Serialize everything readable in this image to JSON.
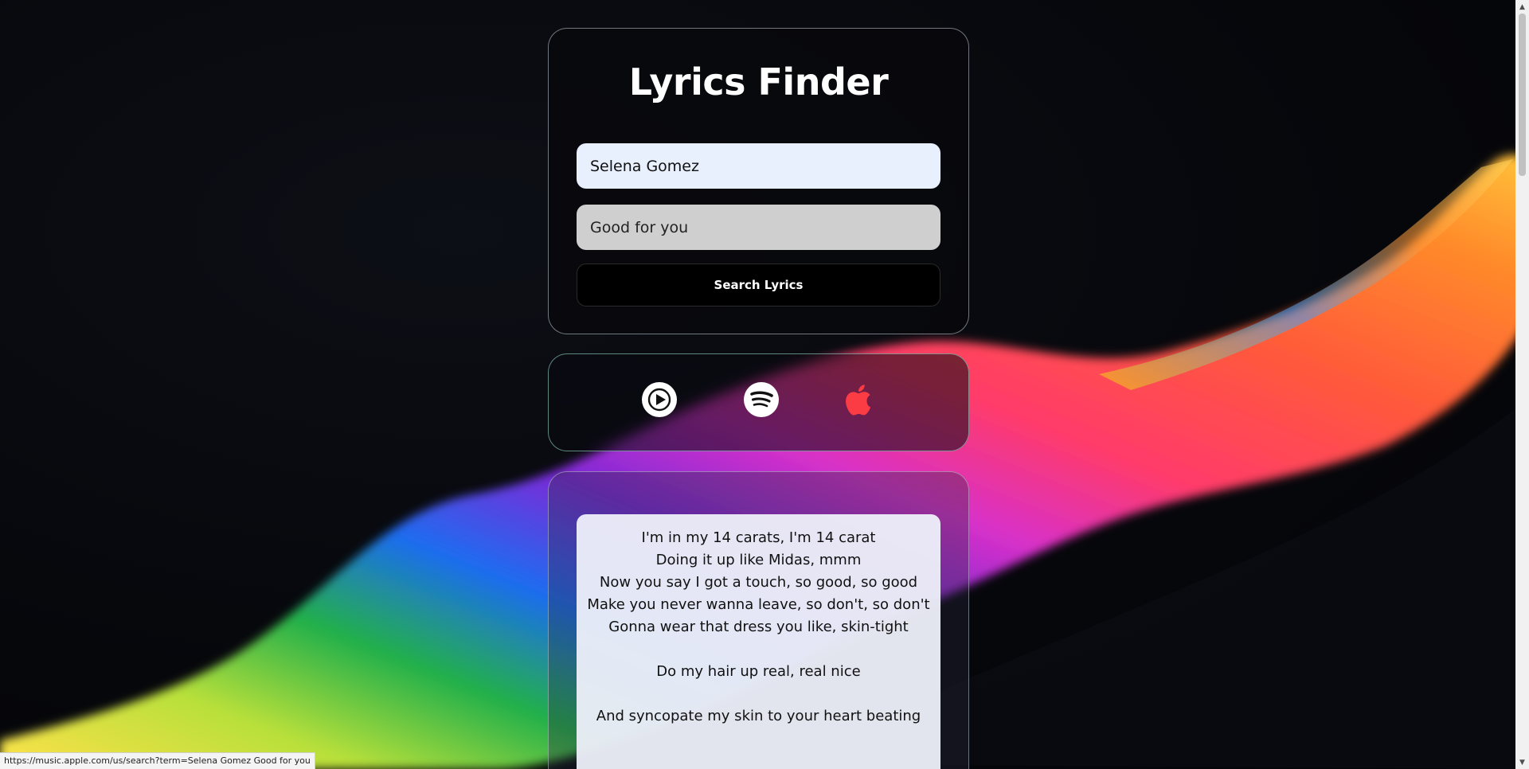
{
  "app": {
    "title": "Lyrics Finder"
  },
  "search": {
    "artist_value": "Selena Gomez",
    "song_value": "Good for you",
    "button_label": "Search Lyrics"
  },
  "services": [
    {
      "name": "YouTube Music",
      "icon": "play-circle-icon",
      "color": "#ffffff"
    },
    {
      "name": "Spotify",
      "icon": "spotify-icon",
      "color": "#ffffff"
    },
    {
      "name": "Apple Music",
      "icon": "apple-icon",
      "color": "#fc3c44"
    }
  ],
  "lyrics": {
    "lines": [
      "I'm in my 14 carats, I'm 14 carat",
      "Doing it up like Midas, mmm",
      "Now you say I got a touch, so good, so good",
      "Make you never wanna leave, so don't, so don't",
      "Gonna wear that dress you like, skin-tight",
      "",
      "Do my hair up real, real nice",
      "",
      "And syncopate my skin to your heart beating"
    ]
  },
  "status_bar": {
    "url": "https://music.apple.com/us/search?term=Selena Gomez Good for you"
  }
}
